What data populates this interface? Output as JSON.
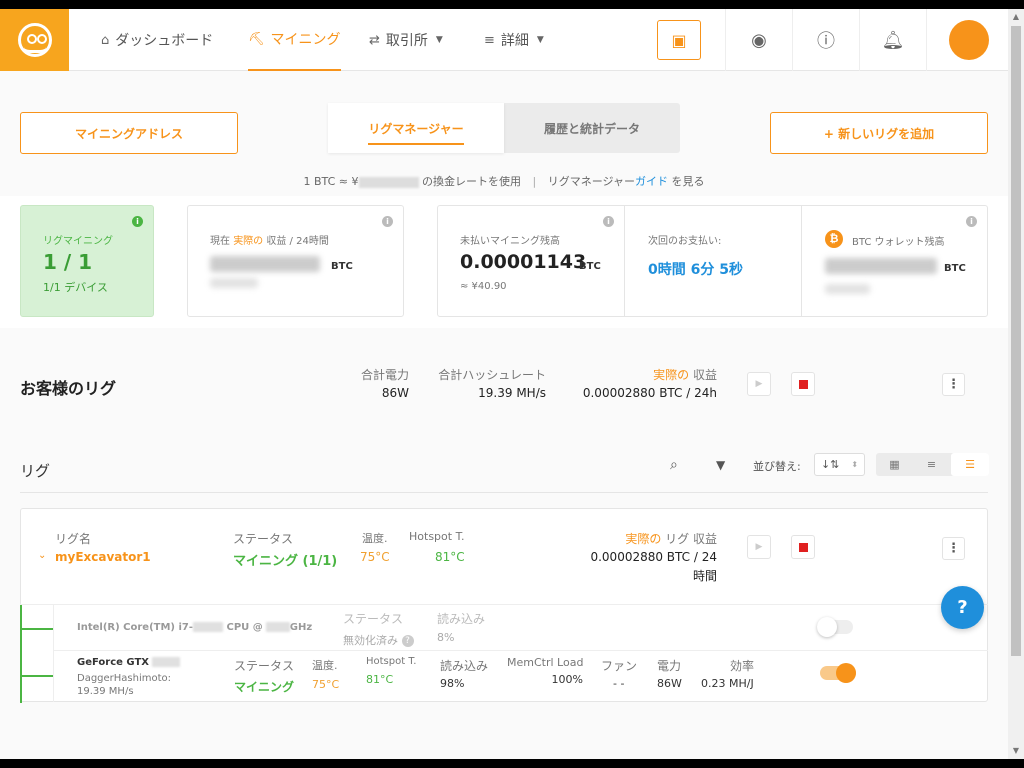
{
  "header": {
    "nav": [
      {
        "label": "ダッシュボード",
        "icon": "home-icon"
      },
      {
        "label": "マイニング",
        "icon": "pickaxe-icon"
      },
      {
        "label": "取引所",
        "icon": "exchange-icon"
      },
      {
        "label": "詳細",
        "icon": "list-icon"
      }
    ]
  },
  "actions": {
    "mining_address": "マイニングアドレス",
    "add_rig": "+ 新しいリグを追加"
  },
  "tabs": {
    "rig_manager": "リグマネージャー",
    "history": "履歴と統計データ"
  },
  "rate_line": {
    "prefix": "1 BTC ≈ ¥",
    "suffix": "の換金レートを使用",
    "sep": "|",
    "guide_prefix": "リグマネージャー",
    "guide_link": "ガイド",
    "guide_suffix": "を見る"
  },
  "stats": {
    "rig_mining": {
      "label": "リグマイニング",
      "value": "1 / 1",
      "devices": "1/1 デバイス"
    },
    "profit": {
      "label_pre": "現在",
      "label_hl": "実際の",
      "label_post": "収益 / 24時間",
      "unit": "BTC"
    },
    "unpaid": {
      "label": "未払いマイニング残高",
      "value": "0.00001143",
      "unit": "BTC",
      "jpy": "≈ ¥40.90"
    },
    "next_payout": {
      "label": "次回のお支払い:",
      "value": "0時間 6分 5秒"
    },
    "wallet": {
      "label": "BTC ウォレット残高",
      "unit": "BTC"
    }
  },
  "your_rigs": {
    "title": "お客様のリグ",
    "total_power_label": "合計電力",
    "total_power": "86W",
    "total_hash_label": "合計ハッシュレート",
    "total_hash": "19.39 MH/s",
    "profit_hl": "実際の",
    "profit_label": "収益",
    "profit": "0.00002880 BTC / 24h"
  },
  "rigs_toolbar": {
    "title": "リグ",
    "sort_label": "並び替え:"
  },
  "rig": {
    "name_label": "リグ名",
    "name": "myExcavator1",
    "status_label": "ステータス",
    "status": "マイニング (1/1)",
    "temp_label": "温度.",
    "temp": "75°C",
    "hotspot_label": "Hotspot T.",
    "hotspot": "81°C",
    "profit_hl": "実際の",
    "profit_label": "リグ 収益",
    "profit_line1": "0.00002880 BTC / 24",
    "profit_line2": "時間"
  },
  "cpu": {
    "name_a": "Intel(R) Core(TM) i7-",
    "name_b": "CPU @",
    "name_c": "GHz",
    "status_label": "ステータス",
    "status": "無効化済み",
    "load_label": "読み込み",
    "load": "8%"
  },
  "gpu": {
    "name": "GeForce GTX",
    "algo": "DaggerHashimoto:",
    "hash": "19.39 MH/s",
    "status_label": "ステータス",
    "status": "マイニング",
    "temp_label": "温度.",
    "temp": "75°C",
    "hotspot_label": "Hotspot T.",
    "hotspot": "81°C",
    "load_label": "読み込み",
    "load": "98%",
    "memctrl_label": "MemCtrl Load",
    "memctrl": "100%",
    "fan_label": "ファン",
    "fan": "- -",
    "power_label": "電力",
    "power": "86W",
    "eff_label": "効率",
    "eff": "0.23 MH/J"
  },
  "help": "?",
  "colors": {
    "accent": "#f7931a",
    "green": "#4bb543",
    "blue": "#1f8fdb",
    "red": "#e02020"
  }
}
